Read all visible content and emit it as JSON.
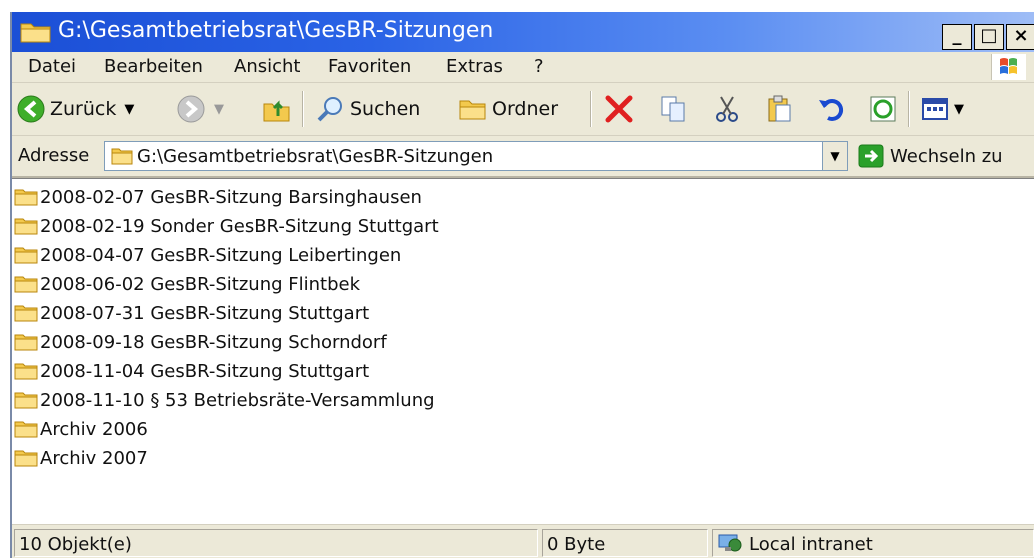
{
  "window": {
    "title": "G:\\Gesamtbetriebsrat\\GesBR-Sitzungen"
  },
  "menu": [
    "Datei",
    "Bearbeiten",
    "Ansicht",
    "Favoriten",
    "Extras",
    "?"
  ],
  "toolbar": {
    "back_label": "Zurück",
    "search_label": "Suchen",
    "folders_label": "Ordner"
  },
  "address": {
    "label": "Adresse",
    "value": "G:\\Gesamtbetriebsrat\\GesBR-Sitzungen",
    "go_label": "Wechseln zu"
  },
  "files": [
    "2008-02-07 GesBR-Sitzung Barsinghausen",
    "2008-02-19 Sonder GesBR-Sitzung Stuttgart",
    "2008-04-07 GesBR-Sitzung Leibertingen",
    "2008-06-02 GesBR-Sitzung Flintbek",
    "2008-07-31 GesBR-Sitzung Stuttgart",
    "2008-09-18 GesBR-Sitzung Schorndorf",
    "2008-11-04 GesBR-Sitzung Stuttgart",
    "2008-11-10 § 53 Betriebsräte-Versammlung",
    "Archiv 2006",
    "Archiv 2007"
  ],
  "status": {
    "count": "10 Objekt(e)",
    "size": "0 Byte",
    "zone": "Local intranet"
  }
}
